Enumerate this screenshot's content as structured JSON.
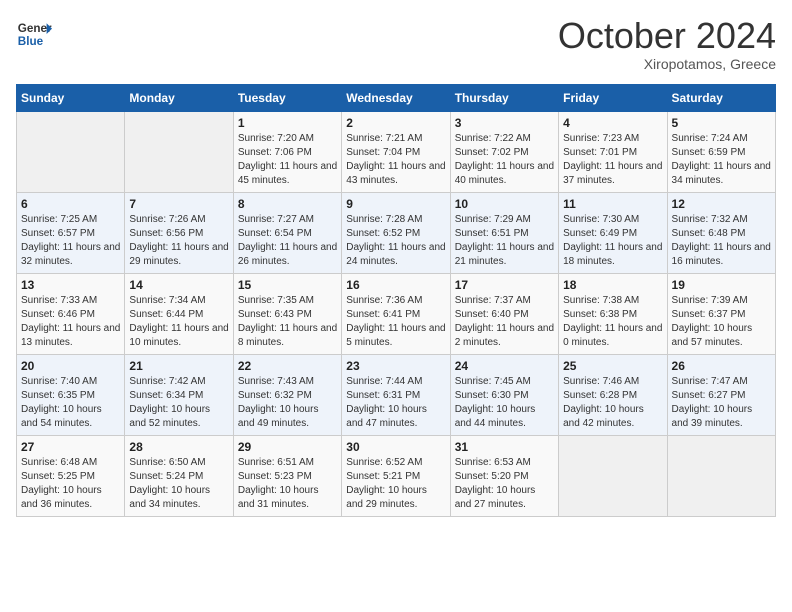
{
  "header": {
    "logo_line1": "General",
    "logo_line2": "Blue",
    "month": "October 2024",
    "location": "Xiropotamos, Greece"
  },
  "weekdays": [
    "Sunday",
    "Monday",
    "Tuesday",
    "Wednesday",
    "Thursday",
    "Friday",
    "Saturday"
  ],
  "weeks": [
    [
      {
        "day": "",
        "sunrise": "",
        "sunset": "",
        "daylight": ""
      },
      {
        "day": "",
        "sunrise": "",
        "sunset": "",
        "daylight": ""
      },
      {
        "day": "1",
        "sunrise": "Sunrise: 7:20 AM",
        "sunset": "Sunset: 7:06 PM",
        "daylight": "Daylight: 11 hours and 45 minutes."
      },
      {
        "day": "2",
        "sunrise": "Sunrise: 7:21 AM",
        "sunset": "Sunset: 7:04 PM",
        "daylight": "Daylight: 11 hours and 43 minutes."
      },
      {
        "day": "3",
        "sunrise": "Sunrise: 7:22 AM",
        "sunset": "Sunset: 7:02 PM",
        "daylight": "Daylight: 11 hours and 40 minutes."
      },
      {
        "day": "4",
        "sunrise": "Sunrise: 7:23 AM",
        "sunset": "Sunset: 7:01 PM",
        "daylight": "Daylight: 11 hours and 37 minutes."
      },
      {
        "day": "5",
        "sunrise": "Sunrise: 7:24 AM",
        "sunset": "Sunset: 6:59 PM",
        "daylight": "Daylight: 11 hours and 34 minutes."
      }
    ],
    [
      {
        "day": "6",
        "sunrise": "Sunrise: 7:25 AM",
        "sunset": "Sunset: 6:57 PM",
        "daylight": "Daylight: 11 hours and 32 minutes."
      },
      {
        "day": "7",
        "sunrise": "Sunrise: 7:26 AM",
        "sunset": "Sunset: 6:56 PM",
        "daylight": "Daylight: 11 hours and 29 minutes."
      },
      {
        "day": "8",
        "sunrise": "Sunrise: 7:27 AM",
        "sunset": "Sunset: 6:54 PM",
        "daylight": "Daylight: 11 hours and 26 minutes."
      },
      {
        "day": "9",
        "sunrise": "Sunrise: 7:28 AM",
        "sunset": "Sunset: 6:52 PM",
        "daylight": "Daylight: 11 hours and 24 minutes."
      },
      {
        "day": "10",
        "sunrise": "Sunrise: 7:29 AM",
        "sunset": "Sunset: 6:51 PM",
        "daylight": "Daylight: 11 hours and 21 minutes."
      },
      {
        "day": "11",
        "sunrise": "Sunrise: 7:30 AM",
        "sunset": "Sunset: 6:49 PM",
        "daylight": "Daylight: 11 hours and 18 minutes."
      },
      {
        "day": "12",
        "sunrise": "Sunrise: 7:32 AM",
        "sunset": "Sunset: 6:48 PM",
        "daylight": "Daylight: 11 hours and 16 minutes."
      }
    ],
    [
      {
        "day": "13",
        "sunrise": "Sunrise: 7:33 AM",
        "sunset": "Sunset: 6:46 PM",
        "daylight": "Daylight: 11 hours and 13 minutes."
      },
      {
        "day": "14",
        "sunrise": "Sunrise: 7:34 AM",
        "sunset": "Sunset: 6:44 PM",
        "daylight": "Daylight: 11 hours and 10 minutes."
      },
      {
        "day": "15",
        "sunrise": "Sunrise: 7:35 AM",
        "sunset": "Sunset: 6:43 PM",
        "daylight": "Daylight: 11 hours and 8 minutes."
      },
      {
        "day": "16",
        "sunrise": "Sunrise: 7:36 AM",
        "sunset": "Sunset: 6:41 PM",
        "daylight": "Daylight: 11 hours and 5 minutes."
      },
      {
        "day": "17",
        "sunrise": "Sunrise: 7:37 AM",
        "sunset": "Sunset: 6:40 PM",
        "daylight": "Daylight: 11 hours and 2 minutes."
      },
      {
        "day": "18",
        "sunrise": "Sunrise: 7:38 AM",
        "sunset": "Sunset: 6:38 PM",
        "daylight": "Daylight: 11 hours and 0 minutes."
      },
      {
        "day": "19",
        "sunrise": "Sunrise: 7:39 AM",
        "sunset": "Sunset: 6:37 PM",
        "daylight": "Daylight: 10 hours and 57 minutes."
      }
    ],
    [
      {
        "day": "20",
        "sunrise": "Sunrise: 7:40 AM",
        "sunset": "Sunset: 6:35 PM",
        "daylight": "Daylight: 10 hours and 54 minutes."
      },
      {
        "day": "21",
        "sunrise": "Sunrise: 7:42 AM",
        "sunset": "Sunset: 6:34 PM",
        "daylight": "Daylight: 10 hours and 52 minutes."
      },
      {
        "day": "22",
        "sunrise": "Sunrise: 7:43 AM",
        "sunset": "Sunset: 6:32 PM",
        "daylight": "Daylight: 10 hours and 49 minutes."
      },
      {
        "day": "23",
        "sunrise": "Sunrise: 7:44 AM",
        "sunset": "Sunset: 6:31 PM",
        "daylight": "Daylight: 10 hours and 47 minutes."
      },
      {
        "day": "24",
        "sunrise": "Sunrise: 7:45 AM",
        "sunset": "Sunset: 6:30 PM",
        "daylight": "Daylight: 10 hours and 44 minutes."
      },
      {
        "day": "25",
        "sunrise": "Sunrise: 7:46 AM",
        "sunset": "Sunset: 6:28 PM",
        "daylight": "Daylight: 10 hours and 42 minutes."
      },
      {
        "day": "26",
        "sunrise": "Sunrise: 7:47 AM",
        "sunset": "Sunset: 6:27 PM",
        "daylight": "Daylight: 10 hours and 39 minutes."
      }
    ],
    [
      {
        "day": "27",
        "sunrise": "Sunrise: 6:48 AM",
        "sunset": "Sunset: 5:25 PM",
        "daylight": "Daylight: 10 hours and 36 minutes."
      },
      {
        "day": "28",
        "sunrise": "Sunrise: 6:50 AM",
        "sunset": "Sunset: 5:24 PM",
        "daylight": "Daylight: 10 hours and 34 minutes."
      },
      {
        "day": "29",
        "sunrise": "Sunrise: 6:51 AM",
        "sunset": "Sunset: 5:23 PM",
        "daylight": "Daylight: 10 hours and 31 minutes."
      },
      {
        "day": "30",
        "sunrise": "Sunrise: 6:52 AM",
        "sunset": "Sunset: 5:21 PM",
        "daylight": "Daylight: 10 hours and 29 minutes."
      },
      {
        "day": "31",
        "sunrise": "Sunrise: 6:53 AM",
        "sunset": "Sunset: 5:20 PM",
        "daylight": "Daylight: 10 hours and 27 minutes."
      },
      {
        "day": "",
        "sunrise": "",
        "sunset": "",
        "daylight": ""
      },
      {
        "day": "",
        "sunrise": "",
        "sunset": "",
        "daylight": ""
      }
    ]
  ]
}
